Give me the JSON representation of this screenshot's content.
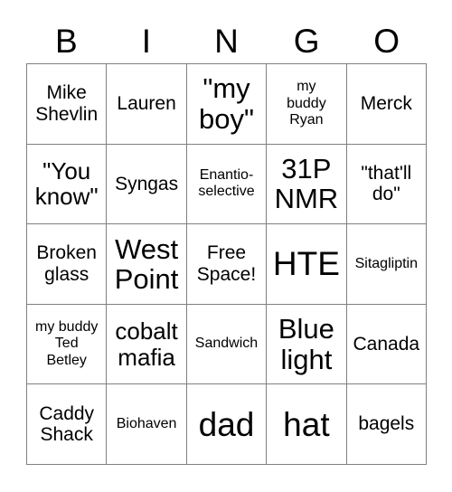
{
  "card": {
    "title": "BINGO",
    "header_letters": [
      "B",
      "I",
      "N",
      "G",
      "O"
    ],
    "grid_size": "5x5",
    "border_color": "#808080",
    "text_color": "#000000",
    "background_color": "#ffffff",
    "free_space": "Free\nSpace!",
    "rows": [
      [
        {
          "text": "Mike\nShevlin",
          "size": "md"
        },
        {
          "text": "Lauren",
          "size": "md"
        },
        {
          "text": "\"my\nboy\"",
          "size": "xl"
        },
        {
          "text": "my\nbuddy\nRyan",
          "size": "sm"
        },
        {
          "text": "Merck",
          "size": "md"
        }
      ],
      [
        {
          "text": "\"You\nknow\"",
          "size": "lg"
        },
        {
          "text": "Syngas",
          "size": "md"
        },
        {
          "text": "Enantio-\nselective",
          "size": "sm"
        },
        {
          "text": "31P\nNMR",
          "size": "xl"
        },
        {
          "text": "\"that'll\ndo\"",
          "size": "md"
        }
      ],
      [
        {
          "text": "Broken\nglass",
          "size": "md"
        },
        {
          "text": "West\nPoint",
          "size": "xl"
        },
        {
          "text": "Free\nSpace!",
          "size": "md"
        },
        {
          "text": "HTE",
          "size": "xxl"
        },
        {
          "text": "Sitagliptin",
          "size": "sm"
        }
      ],
      [
        {
          "text": "my buddy\nTed\nBetley",
          "size": "sm"
        },
        {
          "text": "cobalt\nmafia",
          "size": "lg"
        },
        {
          "text": "Sandwich",
          "size": "sm"
        },
        {
          "text": "Blue\nlight",
          "size": "xl"
        },
        {
          "text": "Canada",
          "size": "md"
        }
      ],
      [
        {
          "text": "Caddy\nShack",
          "size": "md"
        },
        {
          "text": "Biohaven",
          "size": "sm"
        },
        {
          "text": "dad",
          "size": "xxl"
        },
        {
          "text": "hat",
          "size": "xxl"
        },
        {
          "text": "bagels",
          "size": "md"
        }
      ]
    ]
  }
}
